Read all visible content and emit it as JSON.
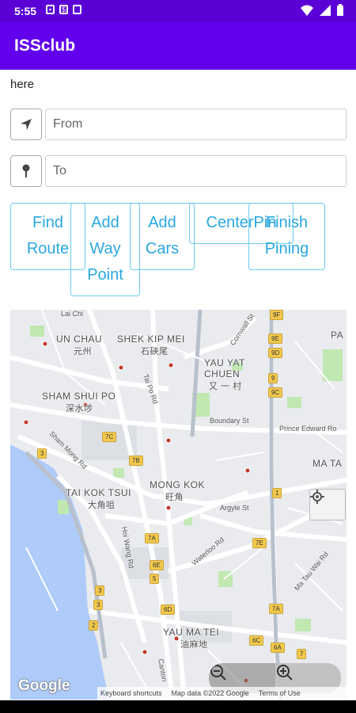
{
  "status_bar": {
    "time": "5:55"
  },
  "app_bar": {
    "title": "ISSclub"
  },
  "here_label": "here",
  "from_field": {
    "placeholder": "From",
    "value": ""
  },
  "to_field": {
    "placeholder": "To",
    "value": ""
  },
  "buttons": {
    "find_route": "Find\nRoute",
    "add_way_point": "Add\nWay\nPoint",
    "add_cars": "Add\nCars",
    "center_pin": "CenterPin",
    "finish_pining": "Finish\nPining"
  },
  "map": {
    "districts": {
      "un_chau": "UN CHAU",
      "un_chau_cjk": "元州",
      "shek_kip_mei": "SHEK KIP MEI",
      "shek_kip_mei_cjk": "石硤尾",
      "sham_shui_po": "SHAM SHUI PO",
      "sham_shui_po_cjk": "深水埗",
      "yau_yat_chuen": "YAU YAT",
      "yau_yat_chuen_2": "CHUEN",
      "yau_yat_chuen_cjk": "又 一 村",
      "mong_kok": "MONG KOK",
      "mong_kok_cjk": "旺角",
      "tai_kok_tsui": "TAI KOK TSUI",
      "tai_kok_tsui_cjk": "大角咀",
      "ma_ta": "MA TA",
      "yau_ma_tei": "YAU MA TEI",
      "yau_ma_tei_cjk": "油麻地",
      "pa": "PA"
    },
    "streets": {
      "boundary_st": "Boundary St",
      "prince_edward_rd": "Prince Edward Ro",
      "argyle_st": "Argyle St",
      "tai_po_rd": "Tai Po Rd",
      "sham_mong_rd": "Sham Mong Rd",
      "hoi_wang_rd": "Hoi Wang Rd",
      "waterloo_rd": "Waterloo Rd",
      "ma_tau_wai_rd": "Ma Tau Wai Rd",
      "cornwall": "Cornwall St",
      "canton": "Canton",
      "lai_chi": "Lai Chi"
    },
    "badges": [
      "3",
      "3",
      "3",
      "2",
      "7C",
      "7B",
      "7A",
      "6E",
      "6D",
      "5",
      "9",
      "9E",
      "9D",
      "9C",
      "9F",
      "1",
      "7E",
      "7A",
      "6C",
      "6A",
      "7"
    ],
    "google_logo": "Google",
    "attribution": {
      "shortcuts": "Keyboard shortcuts",
      "map_data": "Map data ©2022 Google",
      "terms": "Terms of Use"
    }
  },
  "colors": {
    "primary": "#6200ee",
    "status": "#5a00d6",
    "button_text": "#29a8e0",
    "button_border": "#6ccaf0"
  }
}
